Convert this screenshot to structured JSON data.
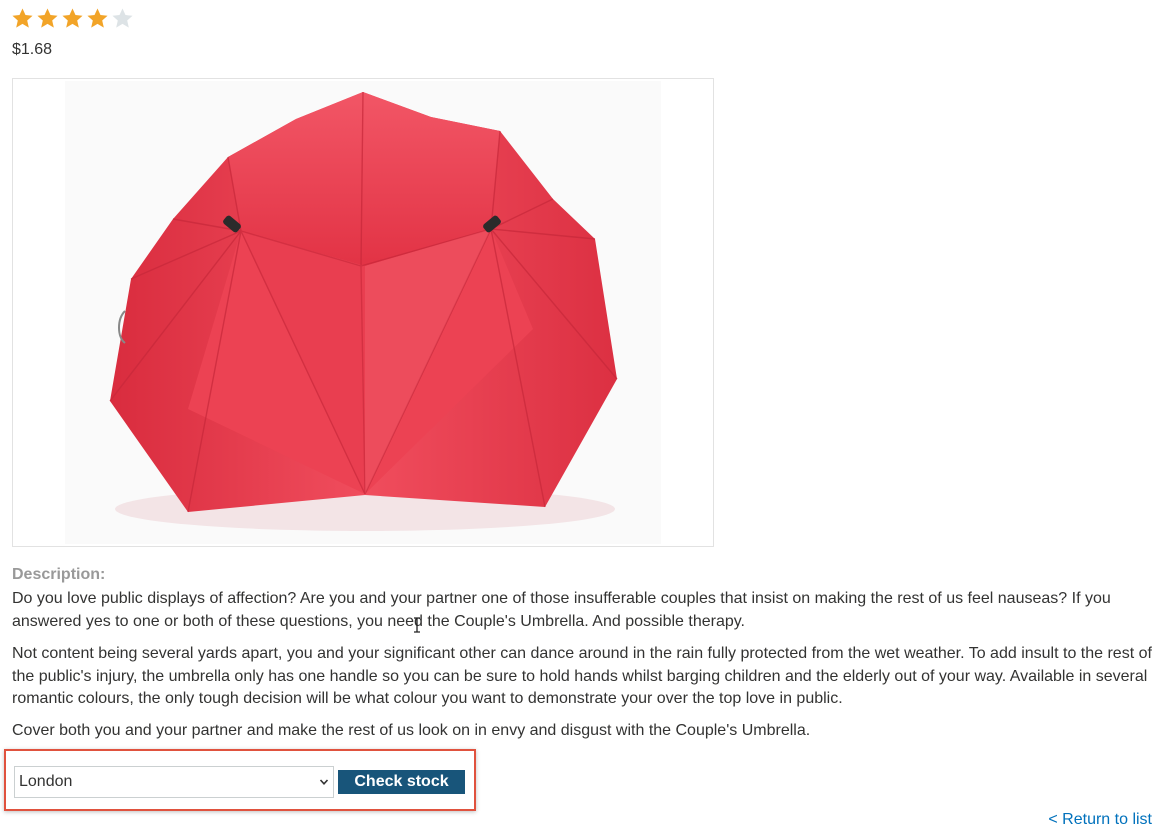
{
  "product": {
    "rating": 4,
    "rating_max": 5,
    "price": "$1.68",
    "image_alt": "Couple's Umbrella"
  },
  "description": {
    "heading": "Description:",
    "paragraphs": [
      "Do you love public displays of affection? Are you and your partner one of those insufferable couples that insist on making the rest of us feel nauseas? If you answered yes to one or both of these questions, you need the Couple's Umbrella. And possible therapy.",
      "Not content being several yards apart, you and your significant other can dance around in the rain fully protected from the wet weather. To add insult to the rest of the public's injury, the umbrella only has one handle so you can be sure to hold hands whilst barging children and the elderly out of your way. Available in several romantic colours, the only tough decision will be what colour you want to demonstrate your over the top love in public.",
      "Cover both you and your partner and make the rest of us look on in envy and disgust with the Couple's Umbrella."
    ]
  },
  "stock_check": {
    "selected_store": "London",
    "button_label": "Check stock"
  },
  "nav": {
    "return_label": "< Return to list"
  },
  "colors": {
    "star_filled": "#f2a428",
    "star_empty": "#dde3e6",
    "button_bg": "#18557a",
    "highlight_border": "#e0523e",
    "link": "#0071bc",
    "umbrella": "#e8404f"
  },
  "icons": {
    "star": "star-icon",
    "select_chevron": "chevron-down-icon"
  }
}
